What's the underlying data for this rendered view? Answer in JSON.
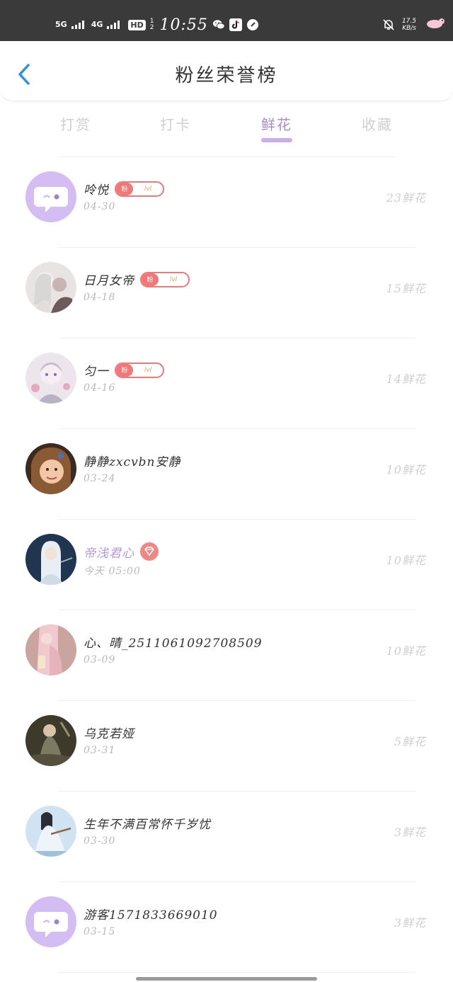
{
  "status_bar": {
    "net1": "5G",
    "net2": "4G",
    "hd": "HD",
    "hd_sub_top": "1",
    "hd_sub_bottom": "2",
    "time": "10:55",
    "speed_value": "17.5",
    "speed_unit": "KB/s",
    "icons": [
      "wechat-icon",
      "tiktok-icon",
      "compass-icon",
      "bell-off-icon",
      "pet-icon"
    ]
  },
  "header": {
    "back_icon": "chevron-left-icon",
    "title": "粉丝荣誉榜"
  },
  "tabs": [
    {
      "label": "打赏",
      "active": false
    },
    {
      "label": "打卡",
      "active": false
    },
    {
      "label": "鲜花",
      "active": true
    },
    {
      "label": "收藏",
      "active": false
    }
  ],
  "badge": {
    "left": "粉",
    "right": "lvl"
  },
  "fans": [
    {
      "name": "呤悦",
      "date": "04-30",
      "count": "23鲜花",
      "badge": true
    },
    {
      "name": "日月女帝",
      "date": "04-18",
      "count": "15鲜花",
      "badge": true
    },
    {
      "name": "匀一",
      "date": "04-16",
      "count": "14鲜花",
      "badge": true
    },
    {
      "name": "静静zxcvbn安静",
      "date": "03-24",
      "count": "10鲜花"
    },
    {
      "name": "帝浅君心",
      "date": "今天 05:00",
      "count": "10鲜花",
      "vip": true
    },
    {
      "name": "心、晴_2511061092708509",
      "date": "03-09",
      "count": "10鲜花"
    },
    {
      "name": "乌克若娅",
      "date": "03-31",
      "count": "5鲜花"
    },
    {
      "name": "生年不满百常怀千岁忧",
      "date": "03-30",
      "count": "3鲜花"
    },
    {
      "name": "游客1571833669010",
      "date": "03-15",
      "count": "3鲜花"
    }
  ],
  "colors": {
    "accent": "#a889d6",
    "badge_red": "#f07878",
    "status_bar": "#3a3a3a"
  }
}
